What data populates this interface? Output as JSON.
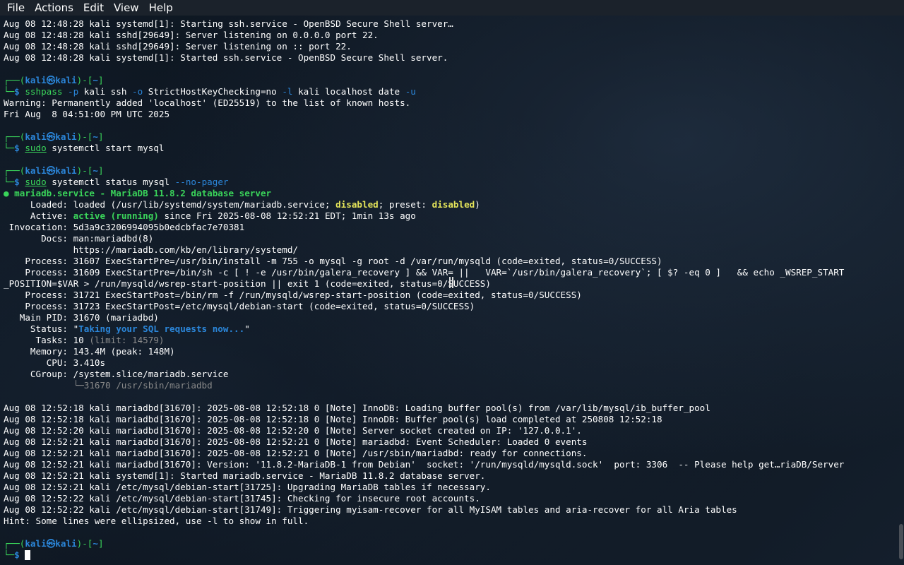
{
  "menubar": {
    "items": [
      "File",
      "Actions",
      "Edit",
      "View",
      "Help"
    ]
  },
  "terminal": {
    "prompt": {
      "user": "kali",
      "sep": "㉿",
      "host": "kali",
      "cwd": "~"
    },
    "lines": [
      "Aug 08 12:48:28 kali systemd[1]: Starting ssh.service - OpenBSD Secure Shell server…",
      "Aug 08 12:48:28 kali sshd[29649]: Server listening on 0.0.0.0 port 22.",
      "Aug 08 12:48:28 kali sshd[29649]: Server listening on :: port 22.",
      "Aug 08 12:48:28 kali systemd[1]: Started ssh.service - OpenBSD Secure Shell server.",
      "",
      "Warning: Permanently added 'localhost' (ED25519) to the list of known hosts.",
      "Fri Aug  8 04:51:00 PM UTC 2025",
      "",
      "",
      "● mariadb.service - MariaDB 11.8.2 database server",
      "     Loaded: loaded (/usr/lib/systemd/system/mariadb.service; ",
      "disabled",
      "; preset: ",
      "disabled",
      ")",
      "     Active: ",
      "active (running)",
      " since Fri 2025-08-08 12:52:21 EDT; 1min 13s ago",
      " Invocation: 5d3a9c3206994095b0edcbfac7e70381",
      "       Docs: man:mariadbd(8)",
      "             https://mariadb.com/kb/en/library/systemd/",
      "    Process: 31607 ExecStartPre=/usr/bin/install -m 755 -o mysql -g root -d /var/run/mysqld (code=exited, status=0/SUCCESS)",
      "    Process: 31609 ExecStartPre=/bin/sh -c [ ! -e /usr/bin/galera_recovery ] && VAR= ||   VAR=`/usr/bin/galera_recovery`; [ $? -eq 0 ]   && echo _WSREP_START",
      "_POSITION=$VAR > /run/mysqld/wsrep-start-position || exit 1 (code=exited, status=0/SUCCESS)",
      "    Process: 31721 ExecStartPost=/bin/rm -f /run/mysqld/wsrep-start-position (code=exited, status=0/SUCCESS)",
      "    Process: 31723 ExecStartPost=/etc/mysql/debian-start (code=exited, status=0/SUCCESS)",
      "   Main PID: 31670 (mariadbd)",
      "     Status: \"",
      "Taking your SQL requests now...",
      "\"",
      "      Tasks: 10 ",
      "(limit: 14579)",
      "     Memory: 143.4M (peak: 148M)",
      "        CPU: 3.410s",
      "     CGroup: /system.slice/mariadb.service",
      "             └─31670 /usr/sbin/mariadbd",
      "",
      "Aug 08 12:52:18 kali mariadbd[31670]: 2025-08-08 12:52:18 0 [Note] InnoDB: Loading buffer pool(s) from /var/lib/mysql/ib_buffer_pool",
      "Aug 08 12:52:18 kali mariadbd[31670]: 2025-08-08 12:52:18 0 [Note] InnoDB: Buffer pool(s) load completed at 250808 12:52:18",
      "Aug 08 12:52:20 kali mariadbd[31670]: 2025-08-08 12:52:20 0 [Note] Server socket created on IP: '127.0.0.1'.",
      "Aug 08 12:52:21 kali mariadbd[31670]: 2025-08-08 12:52:21 0 [Note] mariadbd: Event Scheduler: Loaded 0 events",
      "Aug 08 12:52:21 kali mariadbd[31670]: 2025-08-08 12:52:21 0 [Note] /usr/sbin/mariadbd: ready for connections.",
      "Aug 08 12:52:21 kali mariadbd[31670]: Version: '11.8.2-MariaDB-1 from Debian'  socket: '/run/mysqld/mysqld.sock'  port: 3306  -- Please help get…riaDB/Server",
      "Aug 08 12:52:21 kali systemd[1]: Started mariadb.service - MariaDB 11.8.2 database server.",
      "Aug 08 12:52:21 kali /etc/mysql/debian-start[31725]: Upgrading MariaDB tables if necessary.",
      "Aug 08 12:52:22 kali /etc/mysql/debian-start[31745]: Checking for insecure root accounts.",
      "Aug 08 12:52:22 kali /etc/mysql/debian-start[31749]: Triggering myisam-recover for all MyISAM tables and aria-recover for all Aria tables",
      "Hint: Some lines were ellipsized, use -l to show in full.",
      ""
    ],
    "cmd1": {
      "a": "sshpass",
      "b": " -p",
      "c": " kali ssh",
      "d": " -o",
      "e": " StrictHostKeyChecking=no",
      "f": " -l",
      "g": " kali localhost date",
      "h": " -u"
    },
    "cmd2": {
      "a": "sudo",
      "b": " systemctl start mysql"
    },
    "cmd3": {
      "a": "sudo",
      "b": " systemctl status mysql",
      "c": " --no-pager"
    }
  }
}
